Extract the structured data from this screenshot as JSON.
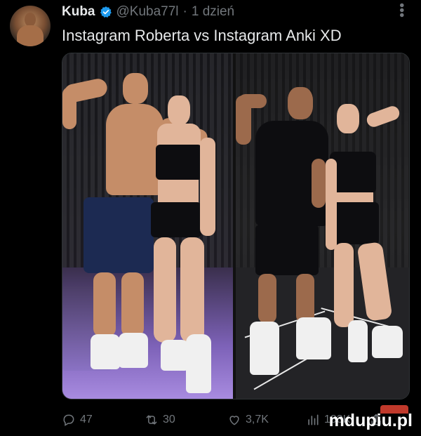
{
  "tweet": {
    "author_name": "Kuba",
    "handle": "@Kuba77l",
    "separator": "·",
    "time": "1 dzień",
    "text": "Instagram Roberta vs Instagram Anki XD"
  },
  "actions": {
    "replies": "47",
    "retweets": "30",
    "likes": "3,7K",
    "views": "183K"
  },
  "watermark": "mdupiu.pl",
  "colors": {
    "background": "#000000",
    "text": "#e7e9ea",
    "muted": "#71767b",
    "verified": "#1d9bf0"
  },
  "icons": [
    "verified-badge-icon",
    "more-icon",
    "reply-icon",
    "retweet-icon",
    "like-icon",
    "views-icon",
    "share-icon"
  ]
}
